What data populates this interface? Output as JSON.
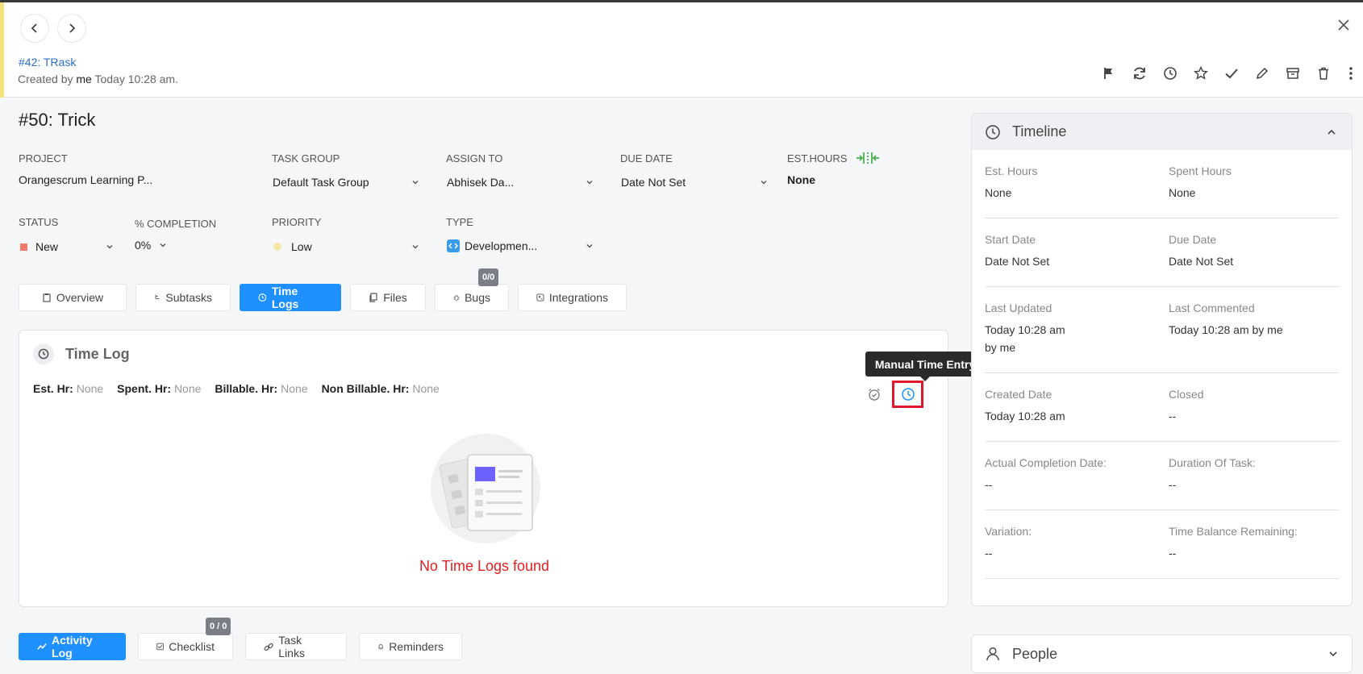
{
  "header": {
    "parent_link": "#42: TRask",
    "created_prefix": "Created by",
    "created_by": "me",
    "created_time": "Today 10:28 am."
  },
  "task": {
    "title": "#50: Trick",
    "fields": {
      "project_label": "PROJECT",
      "project_value": "Orangescrum Learning P...",
      "task_group_label": "TASK GROUP",
      "task_group_value": "Default Task Group",
      "assign_label": "ASSIGN TO",
      "assign_value": "Abhisek Da...",
      "due_label": "DUE DATE",
      "due_value": "Date Not Set",
      "est_label": "EST.HOURS",
      "est_value": "None",
      "status_label": "STATUS",
      "status_value": "New",
      "completion_label": "% COMPLETION",
      "completion_value": "0%",
      "priority_label": "PRIORITY",
      "priority_value": "Low",
      "type_label": "TYPE",
      "type_value": "Developmen..."
    }
  },
  "tabs": [
    {
      "label": "Overview"
    },
    {
      "label": "Subtasks"
    },
    {
      "label": "Time Logs"
    },
    {
      "label": "Files"
    },
    {
      "label": "Bugs"
    },
    {
      "label": "Integrations"
    }
  ],
  "bugs_badge": "0/0",
  "timelog": {
    "title": "Time Log",
    "est_key": "Est. Hr:",
    "est_val": "None",
    "spent_key": "Spent. Hr:",
    "spent_val": "None",
    "billable_key": "Billable. Hr:",
    "billable_val": "None",
    "nonbillable_key": "Non Billable. Hr:",
    "nonbillable_val": "None",
    "tooltip": "Manual Time Entry",
    "empty_text": "No Time Logs found"
  },
  "bottom_tabs": [
    {
      "label": "Activity Log"
    },
    {
      "label": "Checklist"
    },
    {
      "label": "Task Links"
    },
    {
      "label": "Reminders"
    }
  ],
  "checklist_badge": "0 / 0",
  "timeline": {
    "title": "Timeline",
    "rows": [
      {
        "l1": "Est. Hours",
        "v1": "None",
        "l2": "Spent Hours",
        "v2": "None"
      },
      {
        "l1": "Start Date",
        "v1": "Date Not Set",
        "l2": "Due Date",
        "v2": "Date Not Set"
      },
      {
        "l1": "Last Updated",
        "v1": "Today 10:28 am",
        "v1b": "by me",
        "l2": "Last Commented",
        "v2": "Today 10:28 am by me"
      },
      {
        "l1": "Created Date",
        "v1": "Today 10:28 am",
        "l2": "Closed",
        "v2": "--"
      },
      {
        "l1": "Actual Completion Date:",
        "v1": "--",
        "l2": "Duration Of Task:",
        "v2": "--"
      },
      {
        "l1": "Variation:",
        "v1": "--",
        "l2": "Time Balance Remaining:",
        "v2": "--"
      }
    ]
  },
  "people": {
    "title": "People"
  },
  "colors": {
    "accent": "#1e90ff",
    "status_new": "#ef7b6b",
    "priority_low": "#f5e6a3",
    "highlight": "#e0182d"
  }
}
